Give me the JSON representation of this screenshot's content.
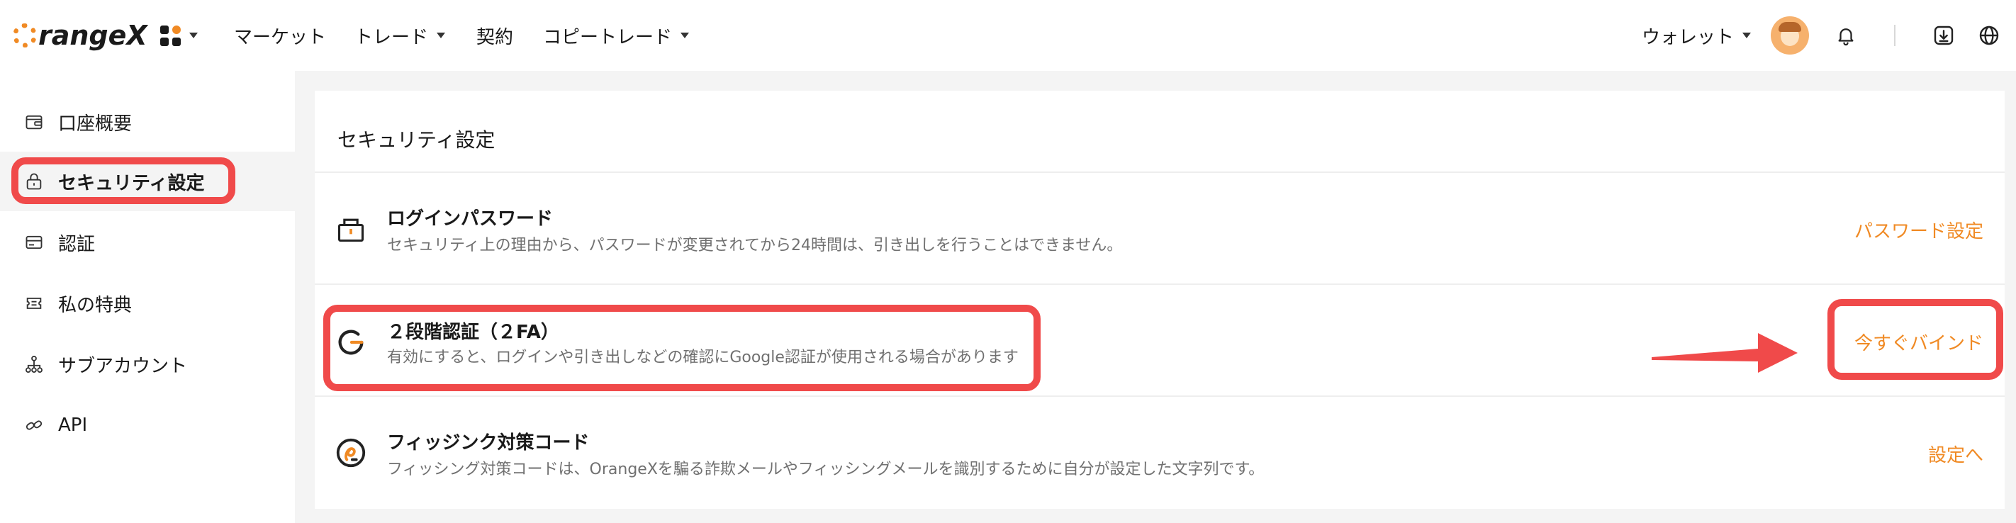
{
  "brand": {
    "name": "rangeX",
    "accent": "#f08a24"
  },
  "nav": {
    "items": [
      {
        "label": "マーケット",
        "has_caret": false
      },
      {
        "label": "トレード",
        "has_caret": true
      },
      {
        "label": "契約",
        "has_caret": false
      },
      {
        "label": "コピートレード",
        "has_caret": true
      }
    ],
    "wallet_label": "ウォレット",
    "icons": [
      "apps-icon",
      "avatar",
      "bell-icon",
      "download-icon",
      "globe-icon"
    ]
  },
  "sidebar": {
    "items": [
      {
        "label": "口座概要",
        "icon": "wallet-icon",
        "active": false
      },
      {
        "label": "セキュリティ設定",
        "icon": "lock-icon",
        "active": true
      },
      {
        "label": "認証",
        "icon": "id-card-icon",
        "active": false
      },
      {
        "label": "私の特典",
        "icon": "ticket-icon",
        "active": false
      },
      {
        "label": "サブアカウント",
        "icon": "hierarchy-icon",
        "active": false
      },
      {
        "label": "API",
        "icon": "api-icon",
        "active": false
      }
    ]
  },
  "security": {
    "title": "セキュリティ設定",
    "rows": [
      {
        "title": "ログインパスワード",
        "description": "セキュリティ上の理由から、パスワードが変更されてから24時間は、引き出しを行うことはできません。",
        "action": "パスワード設定",
        "icon": "padlock-icon"
      },
      {
        "title": "２段階認証（２FA）",
        "description": "有効にすると、ログインや引き出しなどの確認にGoogle認証が使用される場合があります",
        "action": "今すぐバインド",
        "icon": "google-g-icon"
      },
      {
        "title": "フィッジンク対策コード",
        "description": "フィッシング対策コードは、OrangeXを騙る詐欺メールやフィッシングメールを識別するために自分が設定した文字列です。",
        "action": "設定へ",
        "icon": "anti-phishing-icon"
      }
    ]
  },
  "annotation_color": "#f04a4a"
}
